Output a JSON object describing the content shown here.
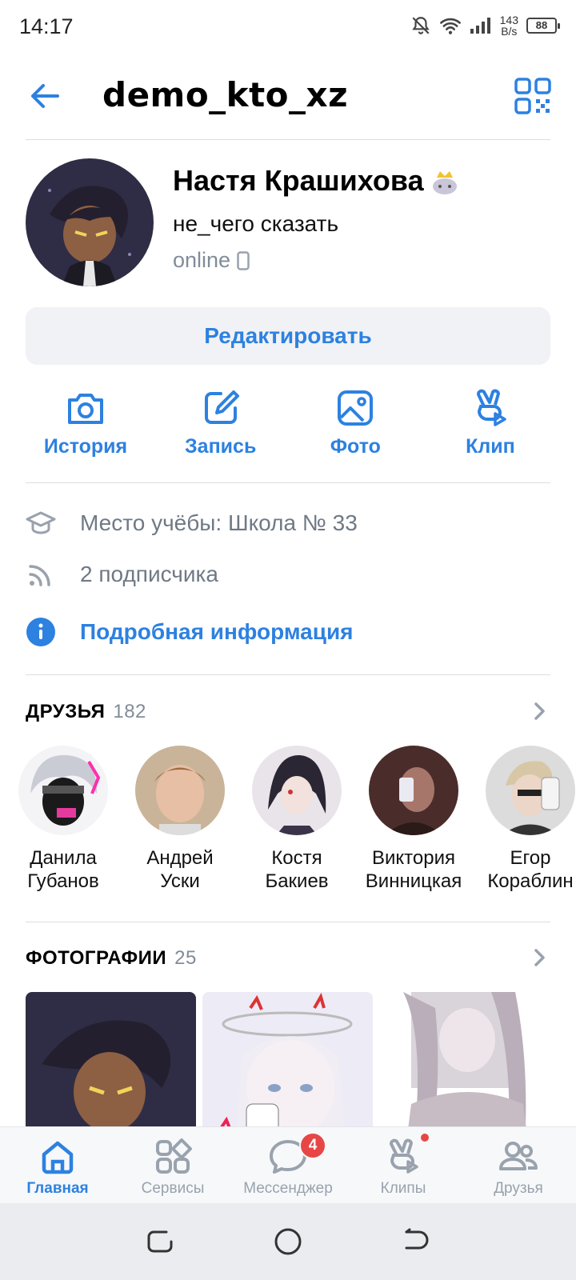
{
  "status_bar": {
    "time": "14:17",
    "speed_value": "143",
    "speed_unit": "B/s",
    "battery": "88"
  },
  "header": {
    "username": "demo_kto_xz"
  },
  "profile": {
    "name": "Настя Крашихова",
    "status": "не_чего сказать",
    "online": "online",
    "edit_label": "Редактировать"
  },
  "actions": [
    {
      "label": "История",
      "icon": "camera-icon"
    },
    {
      "label": "Запись",
      "icon": "edit-icon"
    },
    {
      "label": "Фото",
      "icon": "image-icon"
    },
    {
      "label": "Клип",
      "icon": "clip-icon"
    }
  ],
  "info": {
    "education": "Место учёбы: Школа № 33",
    "followers": "2 подписчика",
    "details": "Подробная информация"
  },
  "friends": {
    "title": "ДРУЗЬЯ",
    "count": "182",
    "items": [
      {
        "name": "Данила\nГубанов"
      },
      {
        "name": "Андрей\nУски"
      },
      {
        "name": "Костя\nБакиев"
      },
      {
        "name": "Виктория\nВинницкая"
      },
      {
        "name": "Егор\nКораблин"
      }
    ]
  },
  "photos": {
    "title": "ФОТОГРАФИИ",
    "count": "25"
  },
  "tabbar": {
    "tabs": [
      {
        "label": "Главная",
        "icon": "home-icon",
        "active": true
      },
      {
        "label": "Сервисы",
        "icon": "services-icon"
      },
      {
        "label": "Мессенджер",
        "icon": "messenger-icon",
        "badge": "4"
      },
      {
        "label": "Клипы",
        "icon": "clips-icon"
      },
      {
        "label": "Друзья",
        "icon": "friends-icon"
      }
    ]
  },
  "colors": {
    "accent": "#2d81e0",
    "muted": "#818c99",
    "badge": "#e64646"
  }
}
